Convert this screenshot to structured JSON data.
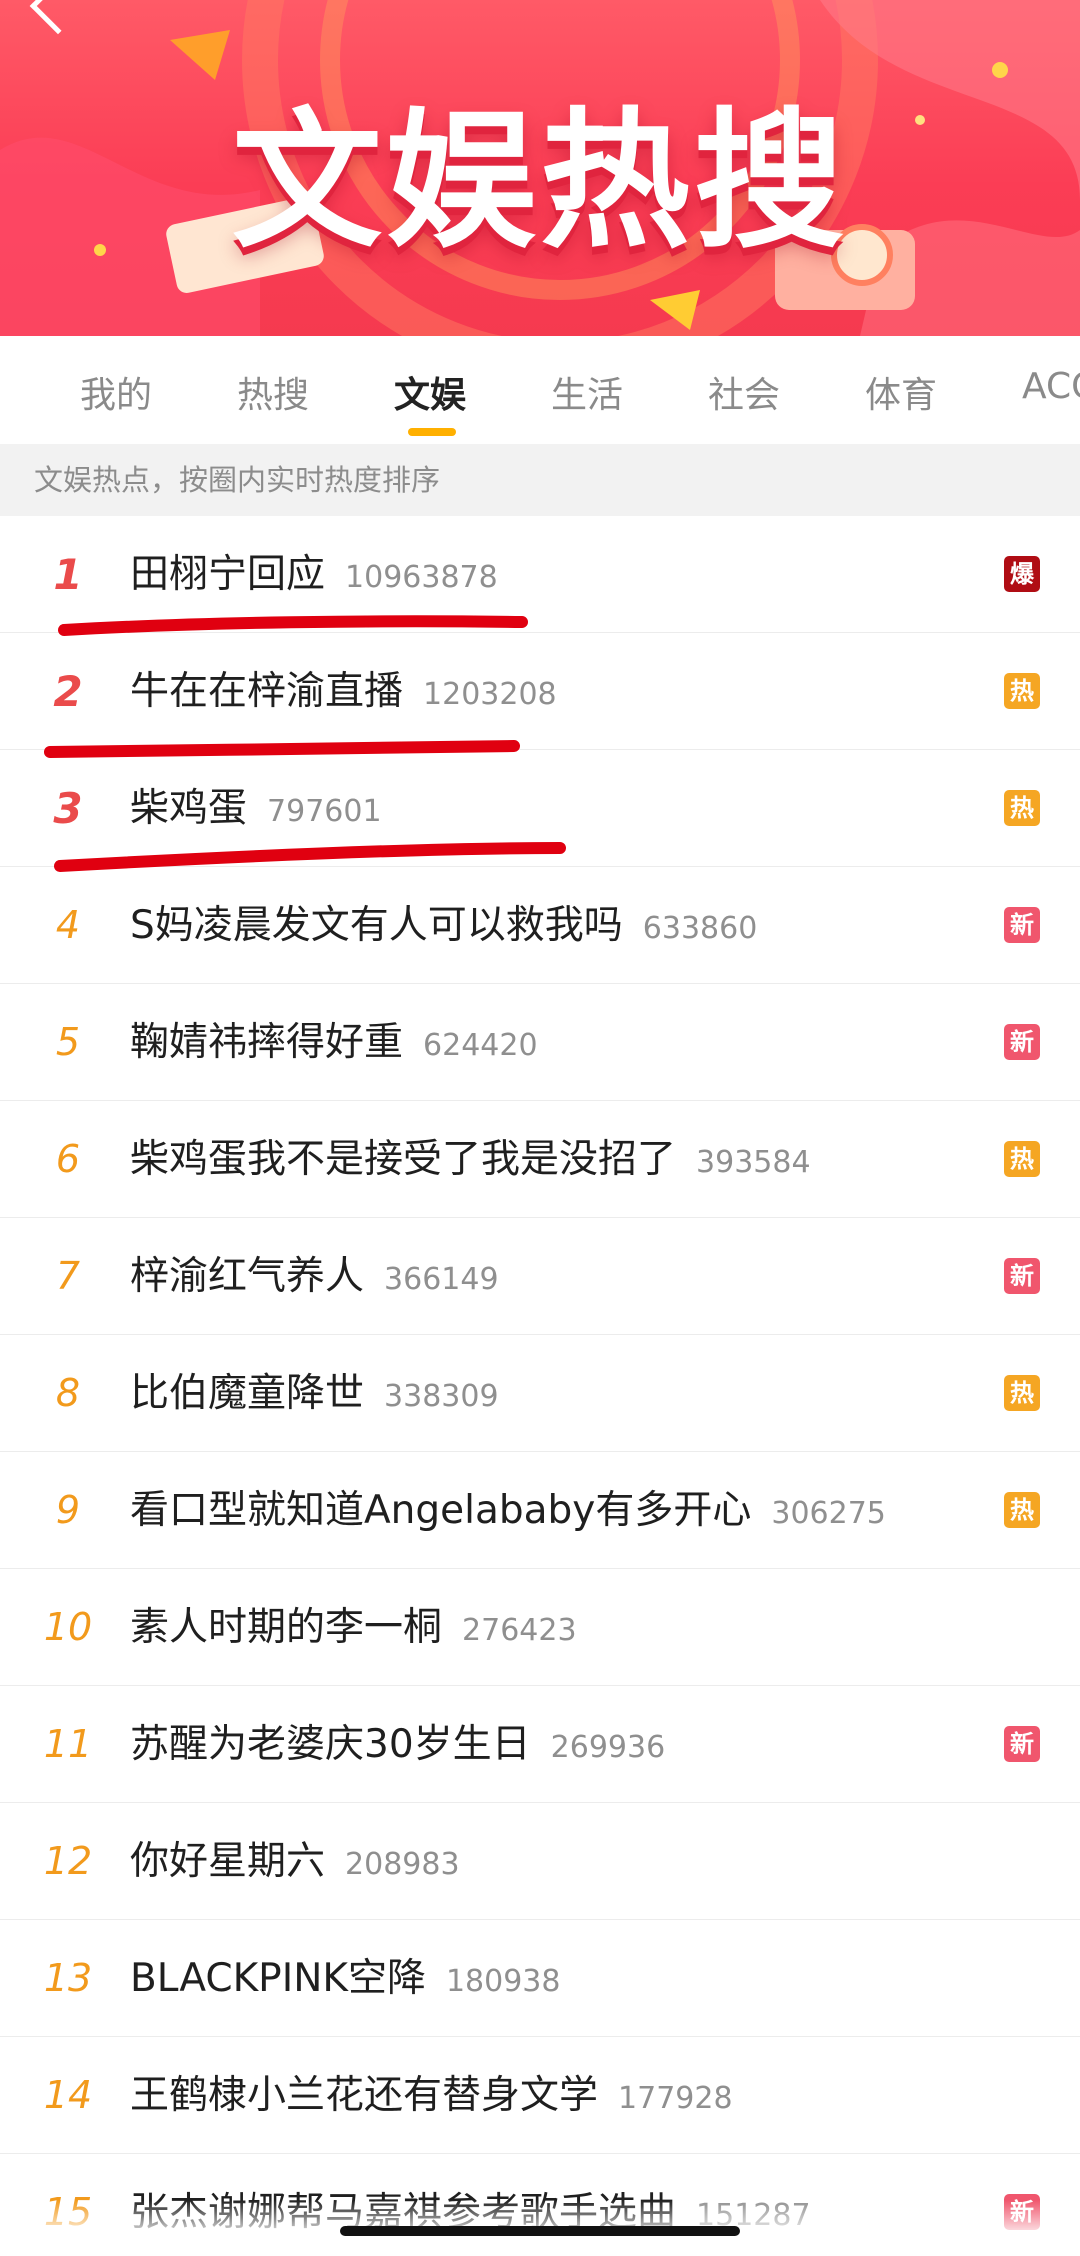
{
  "banner": {
    "title": "文娱热搜",
    "colors": {
      "base": "#fb3d55",
      "accent": "#ffd24a"
    }
  },
  "tabs": [
    {
      "label": "我的"
    },
    {
      "label": "热搜"
    },
    {
      "label": "文娱",
      "active": true
    },
    {
      "label": "生活"
    },
    {
      "label": "社会"
    },
    {
      "label": "体育"
    },
    {
      "label": "ACG"
    }
  ],
  "hint": "文娱热点，按圈内实时热度排序",
  "list": [
    {
      "rank": "1",
      "title": "田栩宁回应",
      "count": "10963878",
      "badge": "爆",
      "badge_type": "bao"
    },
    {
      "rank": "2",
      "title": "牛在在梓渝直播",
      "count": "1203208",
      "badge": "热",
      "badge_type": "re"
    },
    {
      "rank": "3",
      "title": "柴鸡蛋",
      "count": "797601",
      "badge": "热",
      "badge_type": "re"
    },
    {
      "rank": "4",
      "title": "S妈凌晨发文有人可以救我吗",
      "count": "633860",
      "badge": "新",
      "badge_type": "xin"
    },
    {
      "rank": "5",
      "title": "鞠婧祎摔得好重",
      "count": "624420",
      "badge": "新",
      "badge_type": "xin"
    },
    {
      "rank": "6",
      "title": "柴鸡蛋我不是接受了我是没招了",
      "count": "393584",
      "badge": "热",
      "badge_type": "re"
    },
    {
      "rank": "7",
      "title": "梓渝红气养人",
      "count": "366149",
      "badge": "新",
      "badge_type": "xin"
    },
    {
      "rank": "8",
      "title": "比伯魔童降世",
      "count": "338309",
      "badge": "热",
      "badge_type": "re"
    },
    {
      "rank": "9",
      "title": "看口型就知道Angelababy有多开心",
      "count": "306275",
      "badge": "热",
      "badge_type": "re"
    },
    {
      "rank": "10",
      "title": "素人时期的李一桐",
      "count": "276423",
      "badge": "",
      "badge_type": "none"
    },
    {
      "rank": "11",
      "title": "苏醒为老婆庆30岁生日",
      "count": "269936",
      "badge": "新",
      "badge_type": "xin"
    },
    {
      "rank": "12",
      "title": "你好星期六",
      "count": "208983",
      "badge": "",
      "badge_type": "none"
    },
    {
      "rank": "13",
      "title": "BLACKPINK空降",
      "count": "180938",
      "badge": "",
      "badge_type": "none"
    },
    {
      "rank": "14",
      "title": "王鹤棣小兰花还有替身文学",
      "count": "177928",
      "badge": "",
      "badge_type": "none"
    },
    {
      "rank": "15",
      "title": "张杰谢娜帮马嘉祺参考歌手选曲",
      "count": "151287",
      "badge": "新",
      "badge_type": "xin"
    }
  ],
  "colors": {
    "rank_top": "#ea4b4b",
    "rank_other": "#f29a1c",
    "badge_bao": "#b00d14",
    "badge_re": "#f5a623",
    "badge_xin": "#f0566d",
    "tab_indicator": "#ffb000",
    "annotation": "#e00010"
  }
}
